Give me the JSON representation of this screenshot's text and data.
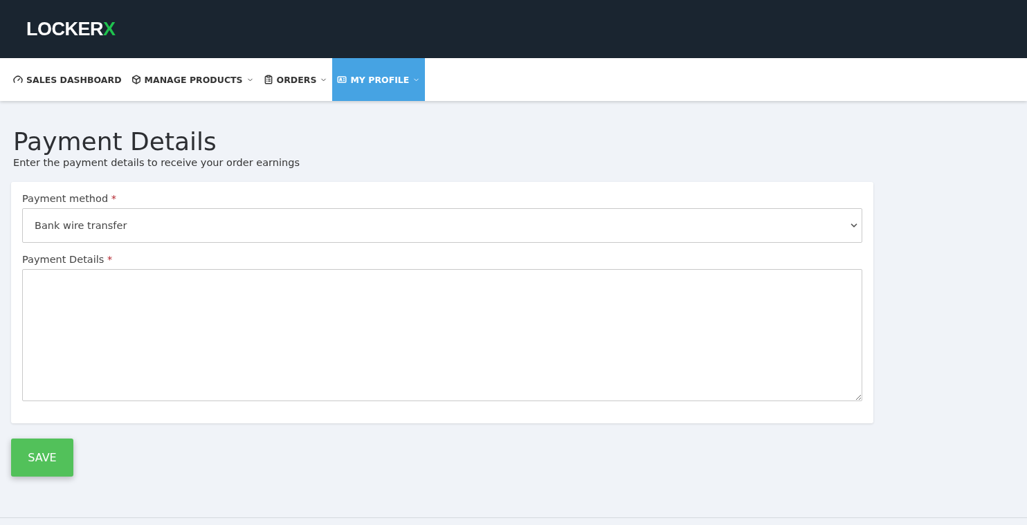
{
  "logo": {
    "text": "LOCKER",
    "accent": "X"
  },
  "nav": [
    {
      "label": "SALES DASHBOARD",
      "dropdown": false,
      "selected": false
    },
    {
      "label": "MANAGE PRODUCTS",
      "dropdown": true,
      "selected": false
    },
    {
      "label": "ORDERS",
      "dropdown": true,
      "selected": false
    },
    {
      "label": "MY PROFILE",
      "dropdown": true,
      "selected": true
    }
  ],
  "page": {
    "title": "Payment Details",
    "subtitle": "Enter the payment details to receive your order earnings"
  },
  "form": {
    "fields": [
      {
        "kind": "select",
        "label": "Payment method",
        "required_mark": "*",
        "value": "Bank wire transfer"
      },
      {
        "kind": "textarea",
        "label": "Payment Details",
        "required_mark": "*"
      }
    ]
  },
  "save_button": "SAVE"
}
